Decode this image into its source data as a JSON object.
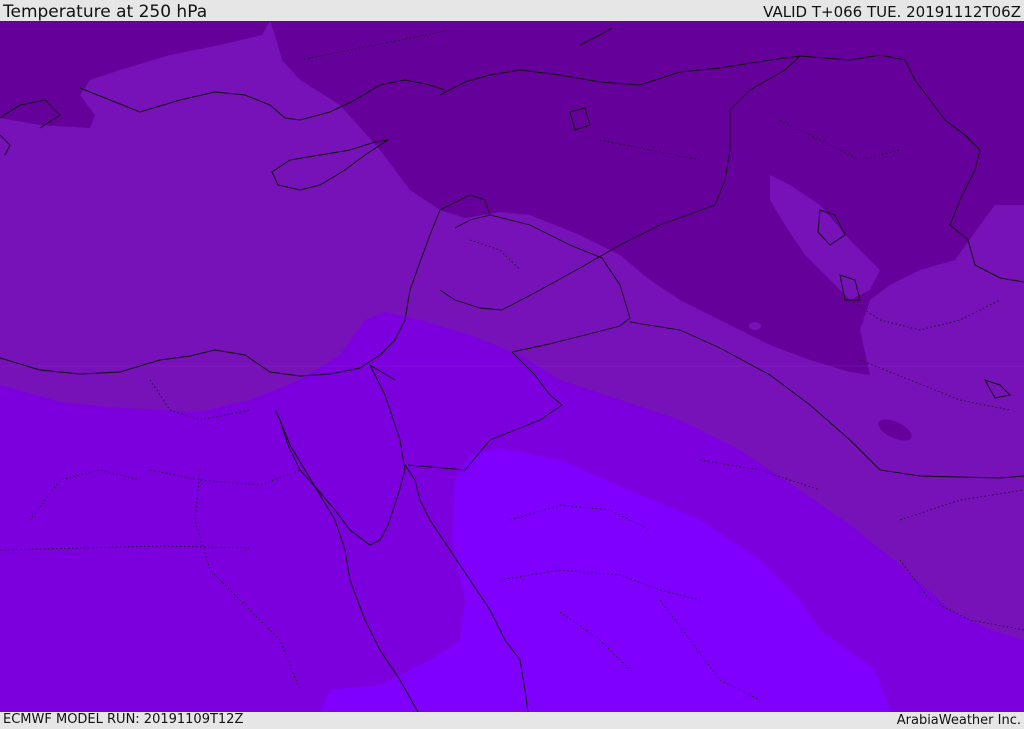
{
  "header": {
    "title": "Temperature at 250 hPa",
    "valid_time": "VALID T+066 TUE. 20191112T06Z"
  },
  "footer": {
    "model_run": "ECMWF MODEL RUN: 20191109T12Z",
    "credit": "ArabiaWeather Inc."
  },
  "colors": {
    "band_coldest": "#65009b",
    "band_cold": "#7711b8",
    "band_mid": "#7c00dd",
    "band_warm": "#8000ff",
    "border_line": "#111111"
  }
}
